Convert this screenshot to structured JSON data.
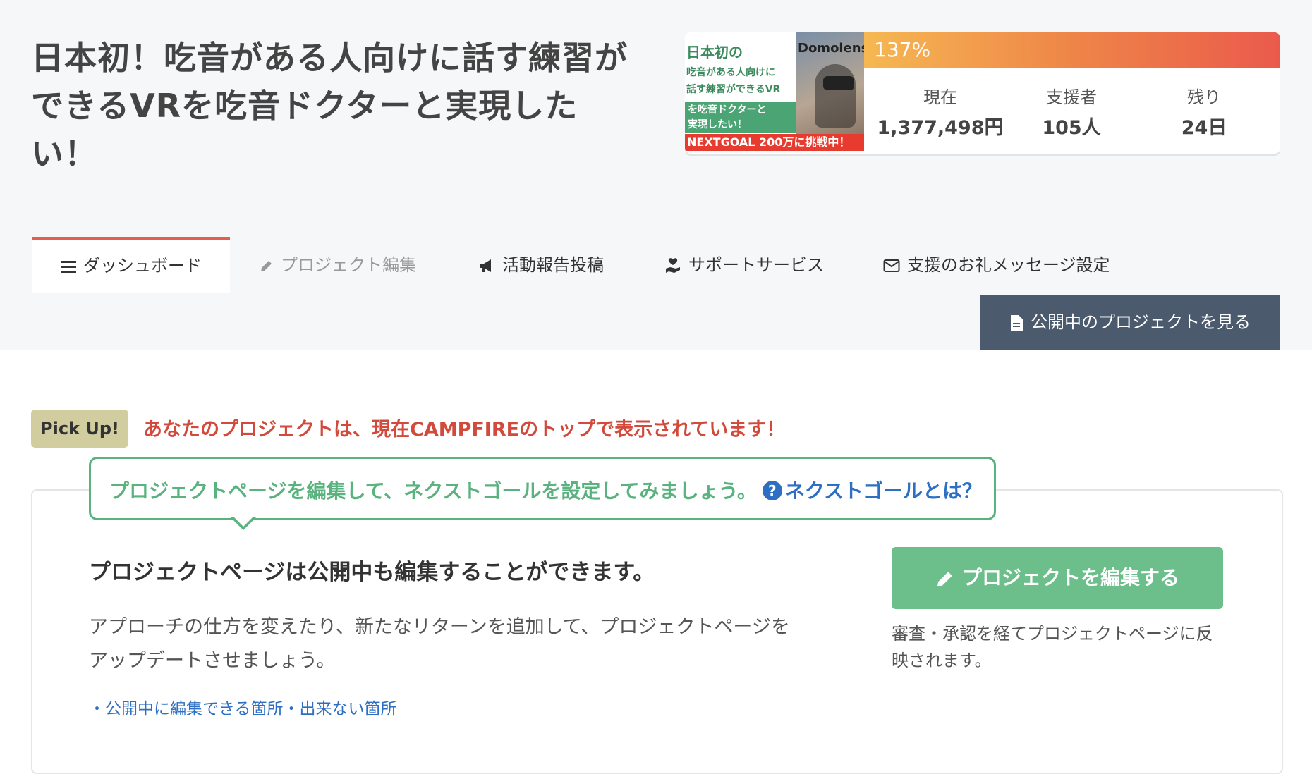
{
  "project": {
    "title": "日本初！吃音がある人向けに話す練習ができるVRを吃音ドクターと実現したい！",
    "thumbnail": {
      "line1": "日本初の",
      "line2": "吃音がある人向けに",
      "line3": "話す練習ができるVR",
      "box_line1": "を吃音ドクターと",
      "box_line2": "実現したい！",
      "brand": "Domolens",
      "banner": "NEXTGOAL 200万に挑戦中！"
    },
    "progress": {
      "percent_label": "137%",
      "percent": 137
    },
    "stats": [
      {
        "label": "現在",
        "value": "1,377,498円"
      },
      {
        "label": "支援者",
        "value": "105人"
      },
      {
        "label": "残り",
        "value": "24日"
      }
    ]
  },
  "tabs": [
    {
      "label": "ダッシュボード",
      "icon": "menu-icon",
      "active": true
    },
    {
      "label": "プロジェクト編集",
      "icon": "pencil-icon",
      "active": false
    },
    {
      "label": "活動報告投稿",
      "icon": "megaphone-icon",
      "active": false
    },
    {
      "label": "サポートサービス",
      "icon": "hand-heart-icon",
      "active": false
    },
    {
      "label": "支援のお礼メッセージ設定",
      "icon": "envelope-icon",
      "active": false
    }
  ],
  "view_button": {
    "label": "公開中のプロジェクトを見る",
    "icon": "document-icon"
  },
  "pickup": {
    "badge": "Pick Up!",
    "message": "あなたのプロジェクトは、現在CAMPFIREのトップで表示されています！"
  },
  "callout": {
    "message": "プロジェクトページを編集して、ネクストゴールを設定してみましょう。",
    "link": "ネクストゴールとは？",
    "link_icon": "question-circle-icon"
  },
  "panel": {
    "heading": "プロジェクトページは公開中も編集することができます。",
    "description": "アプローチの仕方を変えたり、新たなリターンを追加して、プロジェクトページをアップデートさせましょう。",
    "link": "・公開中に編集できる箇所・出来ない箇所",
    "edit_button": "プロジェクトを編集する",
    "note": "審査・承認を経てプロジェクトページに反映されます。"
  },
  "colors": {
    "accent_red": "#e25e4e",
    "green": "#5ab37f",
    "button_green": "#6cbf8b",
    "link_blue": "#2d6fc2",
    "dark_button": "#4b5a6c",
    "pickup_bg": "#d1cd9f",
    "progress_gradient": [
      "#f6b852",
      "#ea5a4c"
    ]
  }
}
